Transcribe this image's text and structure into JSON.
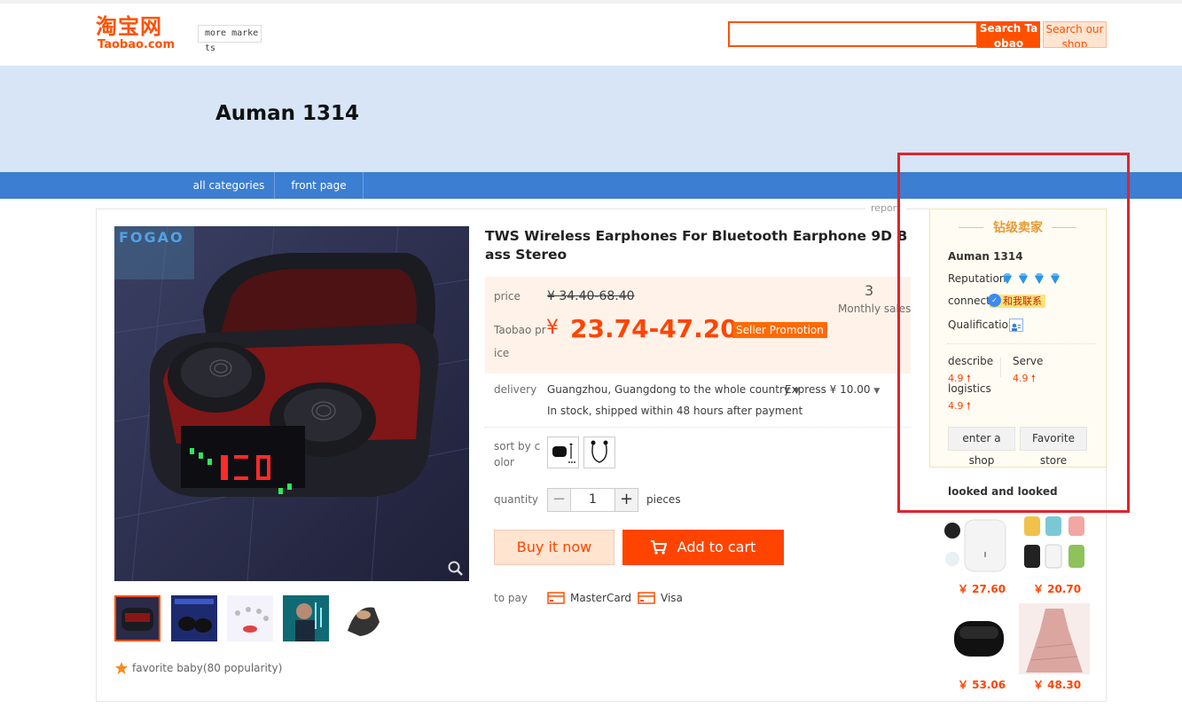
{
  "header": {
    "logo_cn": "淘宝网",
    "logo_en": "Taobao.com",
    "more_markets": "more markets",
    "search_placeholder": "",
    "search_taobao_label": "Search Taobao",
    "search_shop_label": "Search our shop"
  },
  "banner": {
    "shop_title": "Auman 1314"
  },
  "nav": {
    "all_categories": "all categories",
    "front_page": "front page"
  },
  "report": "report",
  "product": {
    "image_brand": "FOGAO",
    "title": "TWS Wireless Earphones For Bluetooth Earphone 9D Bass Stereo",
    "price_label": "price",
    "old_price": "¥ 34.40-68.40",
    "taobao_price_label": "Taobao price",
    "yen": "¥",
    "new_price": "23.74-47.20",
    "promo_badge": "Seller Promotion",
    "monthly_sales_count": "3",
    "monthly_sales_label": "Monthly sales",
    "delivery_label": "delivery",
    "delivery_route": "Guangzhou, Guangdong to the whole country",
    "express": "Express ¥ 10.00",
    "stock": "In stock, shipped within 48 hours after payment",
    "sort_by_color_label": "sort by color",
    "quantity_label": "quantity",
    "quantity_value": "1",
    "quantity_minus": "−",
    "quantity_plus": "+",
    "pieces_label": "pieces",
    "buy_now": "Buy it now",
    "add_to_cart": "Add to cart",
    "to_pay_label": "to pay",
    "pay_methods": [
      "MasterCard",
      "Visa"
    ],
    "favorite": "favorite baby(80 popularity)"
  },
  "seller": {
    "rank": "钻级卖家",
    "name": "Auman 1314",
    "reputation_label": "Reputation:",
    "connect_label": "connect:",
    "contact_badge": "和我联系",
    "qualification_label": "Qualification:",
    "describe_label": "describe",
    "describe_score": "4.9",
    "serve_label": "Serve",
    "serve_score": "4.9",
    "logistics_label": "logistics",
    "logistics_score": "4.9",
    "enter_shop": "enter a shop",
    "favorite_store": "Favorite store",
    "looked_title": "looked and looked",
    "looked_prices": [
      "￥ 27.60",
      "￥ 20.70",
      "￥ 53.06",
      "￥ 48.30"
    ]
  },
  "colors": {
    "brand_orange": "#ff5000",
    "price_red": "#ff4400",
    "nav_blue": "#3c7ed1",
    "banner_blue": "#d7e5f7",
    "highlight_red": "#e0232e"
  }
}
